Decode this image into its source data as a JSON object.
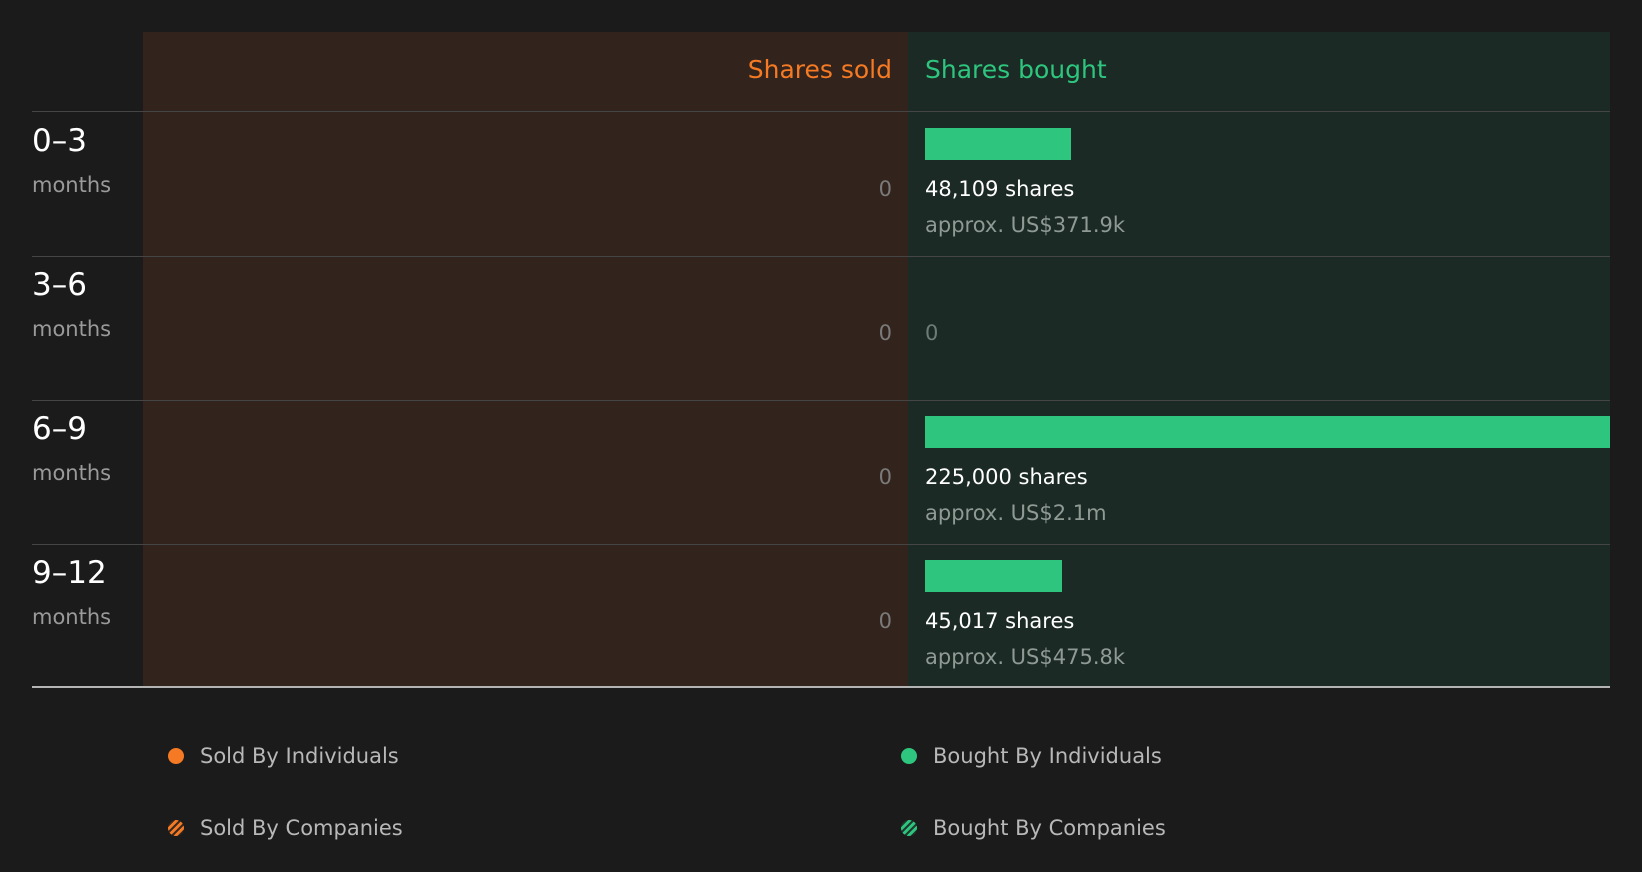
{
  "headers": {
    "sold": "Shares sold",
    "bought": "Shares bought"
  },
  "colors": {
    "sold": "#f57a23",
    "bought": "#2ec67e",
    "sold_panel": "#32241d",
    "bought_panel": "#1b2a24",
    "background": "#1b1b1b"
  },
  "rows": [
    {
      "period": "0–3",
      "unit": "months",
      "sold": "0",
      "bought_shares": "48,109 shares",
      "bought_approx": "approx. US$371.9k"
    },
    {
      "period": "3–6",
      "unit": "months",
      "sold": "0",
      "bought_zero": "0"
    },
    {
      "period": "6–9",
      "unit": "months",
      "sold": "0",
      "bought_shares": "225,000 shares",
      "bought_approx": "approx. US$2.1m"
    },
    {
      "period": "9–12",
      "unit": "months",
      "sold": "0",
      "bought_shares": "45,017 shares",
      "bought_approx": "approx. US$475.8k"
    }
  ],
  "legend": {
    "sold_individuals": "Sold By Individuals",
    "bought_individuals": "Bought By Individuals",
    "sold_companies": "Sold By Companies",
    "bought_companies": "Bought By Companies"
  },
  "chart_data": {
    "type": "bar",
    "categories": [
      "0–3",
      "3–6",
      "6–9",
      "9–12"
    ],
    "series": [
      {
        "name": "Shares sold",
        "values": [
          0,
          0,
          0,
          0
        ]
      },
      {
        "name": "Shares bought",
        "values": [
          48109,
          0,
          225000,
          45017
        ]
      }
    ],
    "approx_value_usd": [
      "US$371.9k",
      null,
      "US$2.1m",
      "US$475.8k"
    ],
    "xlabel": "",
    "ylabel": "",
    "xlim": [
      0,
      225000
    ],
    "legend_position": "bottom",
    "grid": false
  }
}
